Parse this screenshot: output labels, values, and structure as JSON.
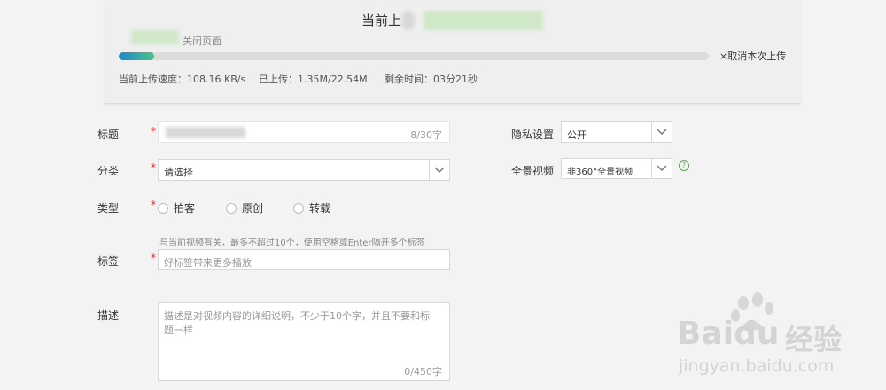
{
  "upload": {
    "title": "当前上",
    "subtitle": "关闭页面",
    "progress": 0.06,
    "cancel_label": "×取消本次上传",
    "speed": "当前上传速度：108.16 KB/s",
    "uploaded": "已上传：1.35M/22.54M",
    "remaining": "剩余时间：03分21秒",
    "progress_colors": [
      "#1e88c8",
      "#4cc08a"
    ]
  },
  "form": {
    "required_mark": "*",
    "title_label": "标题",
    "title_count": "8/30字",
    "category_label": "分类",
    "category_placeholder": "请选择",
    "type_label": "类型",
    "type_options": [
      "拍客",
      "原创",
      "转载"
    ],
    "tags_hint": "与当前视频有关，最多不超过10个，使用空格或Enter隔开多个标签",
    "tags_label": "标签",
    "tags_placeholder": "好标签带来更多播放",
    "desc_label": "描述",
    "desc_placeholder": "描述是对视频内容的详细说明，不少于10个字，并且不要和标题一样",
    "desc_count": "0/450字",
    "privacy_label": "隐私设置",
    "privacy_value": "公开",
    "panorama_label": "全景视频",
    "panorama_value": "非360°全景视频",
    "help_icon": "?"
  },
  "watermark": {
    "brand": "Bai",
    "brand2": "du",
    "cn": "经验",
    "url": "jingyan.baidu.com"
  }
}
